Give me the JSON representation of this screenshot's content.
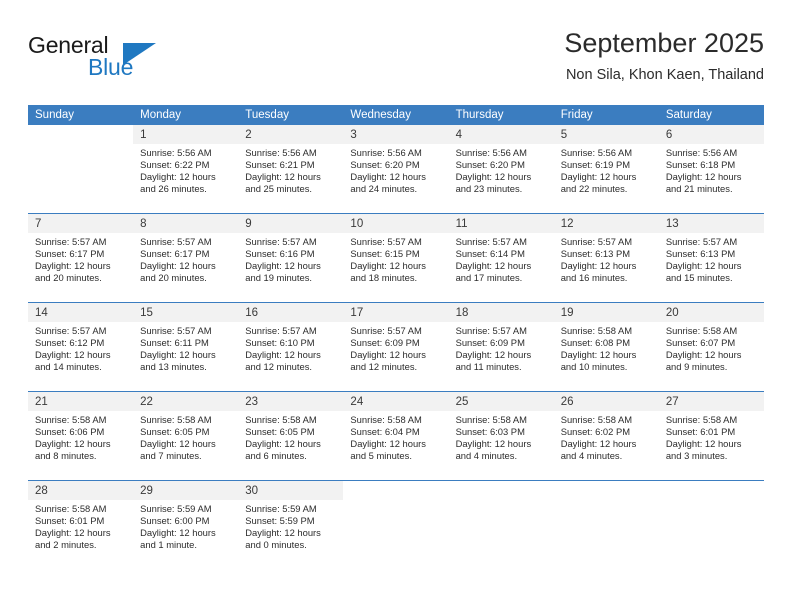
{
  "brand": {
    "line1": "General",
    "line2": "Blue",
    "accent_color": "#1f78c1"
  },
  "header": {
    "month_title": "September 2025",
    "location": "Non Sila, Khon Kaen, Thailand"
  },
  "calendar": {
    "header_color": "#3b7dc0",
    "daynum_band_color": "#f2f2f2",
    "weekday_headers": [
      "Sunday",
      "Monday",
      "Tuesday",
      "Wednesday",
      "Thursday",
      "Friday",
      "Saturday"
    ],
    "weeks": [
      [
        {
          "day": "",
          "sunrise": "",
          "sunset": "",
          "daylight1": "",
          "daylight2": ""
        },
        {
          "day": "1",
          "sunrise": "Sunrise: 5:56 AM",
          "sunset": "Sunset: 6:22 PM",
          "daylight1": "Daylight: 12 hours",
          "daylight2": "and 26 minutes."
        },
        {
          "day": "2",
          "sunrise": "Sunrise: 5:56 AM",
          "sunset": "Sunset: 6:21 PM",
          "daylight1": "Daylight: 12 hours",
          "daylight2": "and 25 minutes."
        },
        {
          "day": "3",
          "sunrise": "Sunrise: 5:56 AM",
          "sunset": "Sunset: 6:20 PM",
          "daylight1": "Daylight: 12 hours",
          "daylight2": "and 24 minutes."
        },
        {
          "day": "4",
          "sunrise": "Sunrise: 5:56 AM",
          "sunset": "Sunset: 6:20 PM",
          "daylight1": "Daylight: 12 hours",
          "daylight2": "and 23 minutes."
        },
        {
          "day": "5",
          "sunrise": "Sunrise: 5:56 AM",
          "sunset": "Sunset: 6:19 PM",
          "daylight1": "Daylight: 12 hours",
          "daylight2": "and 22 minutes."
        },
        {
          "day": "6",
          "sunrise": "Sunrise: 5:56 AM",
          "sunset": "Sunset: 6:18 PM",
          "daylight1": "Daylight: 12 hours",
          "daylight2": "and 21 minutes."
        }
      ],
      [
        {
          "day": "7",
          "sunrise": "Sunrise: 5:57 AM",
          "sunset": "Sunset: 6:17 PM",
          "daylight1": "Daylight: 12 hours",
          "daylight2": "and 20 minutes."
        },
        {
          "day": "8",
          "sunrise": "Sunrise: 5:57 AM",
          "sunset": "Sunset: 6:17 PM",
          "daylight1": "Daylight: 12 hours",
          "daylight2": "and 20 minutes."
        },
        {
          "day": "9",
          "sunrise": "Sunrise: 5:57 AM",
          "sunset": "Sunset: 6:16 PM",
          "daylight1": "Daylight: 12 hours",
          "daylight2": "and 19 minutes."
        },
        {
          "day": "10",
          "sunrise": "Sunrise: 5:57 AM",
          "sunset": "Sunset: 6:15 PM",
          "daylight1": "Daylight: 12 hours",
          "daylight2": "and 18 minutes."
        },
        {
          "day": "11",
          "sunrise": "Sunrise: 5:57 AM",
          "sunset": "Sunset: 6:14 PM",
          "daylight1": "Daylight: 12 hours",
          "daylight2": "and 17 minutes."
        },
        {
          "day": "12",
          "sunrise": "Sunrise: 5:57 AM",
          "sunset": "Sunset: 6:13 PM",
          "daylight1": "Daylight: 12 hours",
          "daylight2": "and 16 minutes."
        },
        {
          "day": "13",
          "sunrise": "Sunrise: 5:57 AM",
          "sunset": "Sunset: 6:13 PM",
          "daylight1": "Daylight: 12 hours",
          "daylight2": "and 15 minutes."
        }
      ],
      [
        {
          "day": "14",
          "sunrise": "Sunrise: 5:57 AM",
          "sunset": "Sunset: 6:12 PM",
          "daylight1": "Daylight: 12 hours",
          "daylight2": "and 14 minutes."
        },
        {
          "day": "15",
          "sunrise": "Sunrise: 5:57 AM",
          "sunset": "Sunset: 6:11 PM",
          "daylight1": "Daylight: 12 hours",
          "daylight2": "and 13 minutes."
        },
        {
          "day": "16",
          "sunrise": "Sunrise: 5:57 AM",
          "sunset": "Sunset: 6:10 PM",
          "daylight1": "Daylight: 12 hours",
          "daylight2": "and 12 minutes."
        },
        {
          "day": "17",
          "sunrise": "Sunrise: 5:57 AM",
          "sunset": "Sunset: 6:09 PM",
          "daylight1": "Daylight: 12 hours",
          "daylight2": "and 12 minutes."
        },
        {
          "day": "18",
          "sunrise": "Sunrise: 5:57 AM",
          "sunset": "Sunset: 6:09 PM",
          "daylight1": "Daylight: 12 hours",
          "daylight2": "and 11 minutes."
        },
        {
          "day": "19",
          "sunrise": "Sunrise: 5:58 AM",
          "sunset": "Sunset: 6:08 PM",
          "daylight1": "Daylight: 12 hours",
          "daylight2": "and 10 minutes."
        },
        {
          "day": "20",
          "sunrise": "Sunrise: 5:58 AM",
          "sunset": "Sunset: 6:07 PM",
          "daylight1": "Daylight: 12 hours",
          "daylight2": "and 9 minutes."
        }
      ],
      [
        {
          "day": "21",
          "sunrise": "Sunrise: 5:58 AM",
          "sunset": "Sunset: 6:06 PM",
          "daylight1": "Daylight: 12 hours",
          "daylight2": "and 8 minutes."
        },
        {
          "day": "22",
          "sunrise": "Sunrise: 5:58 AM",
          "sunset": "Sunset: 6:05 PM",
          "daylight1": "Daylight: 12 hours",
          "daylight2": "and 7 minutes."
        },
        {
          "day": "23",
          "sunrise": "Sunrise: 5:58 AM",
          "sunset": "Sunset: 6:05 PM",
          "daylight1": "Daylight: 12 hours",
          "daylight2": "and 6 minutes."
        },
        {
          "day": "24",
          "sunrise": "Sunrise: 5:58 AM",
          "sunset": "Sunset: 6:04 PM",
          "daylight1": "Daylight: 12 hours",
          "daylight2": "and 5 minutes."
        },
        {
          "day": "25",
          "sunrise": "Sunrise: 5:58 AM",
          "sunset": "Sunset: 6:03 PM",
          "daylight1": "Daylight: 12 hours",
          "daylight2": "and 4 minutes."
        },
        {
          "day": "26",
          "sunrise": "Sunrise: 5:58 AM",
          "sunset": "Sunset: 6:02 PM",
          "daylight1": "Daylight: 12 hours",
          "daylight2": "and 4 minutes."
        },
        {
          "day": "27",
          "sunrise": "Sunrise: 5:58 AM",
          "sunset": "Sunset: 6:01 PM",
          "daylight1": "Daylight: 12 hours",
          "daylight2": "and 3 minutes."
        }
      ],
      [
        {
          "day": "28",
          "sunrise": "Sunrise: 5:58 AM",
          "sunset": "Sunset: 6:01 PM",
          "daylight1": "Daylight: 12 hours",
          "daylight2": "and 2 minutes."
        },
        {
          "day": "29",
          "sunrise": "Sunrise: 5:59 AM",
          "sunset": "Sunset: 6:00 PM",
          "daylight1": "Daylight: 12 hours",
          "daylight2": "and 1 minute."
        },
        {
          "day": "30",
          "sunrise": "Sunrise: 5:59 AM",
          "sunset": "Sunset: 5:59 PM",
          "daylight1": "Daylight: 12 hours",
          "daylight2": "and 0 minutes."
        },
        {
          "day": "",
          "sunrise": "",
          "sunset": "",
          "daylight1": "",
          "daylight2": ""
        },
        {
          "day": "",
          "sunrise": "",
          "sunset": "",
          "daylight1": "",
          "daylight2": ""
        },
        {
          "day": "",
          "sunrise": "",
          "sunset": "",
          "daylight1": "",
          "daylight2": ""
        },
        {
          "day": "",
          "sunrise": "",
          "sunset": "",
          "daylight1": "",
          "daylight2": ""
        }
      ]
    ]
  }
}
